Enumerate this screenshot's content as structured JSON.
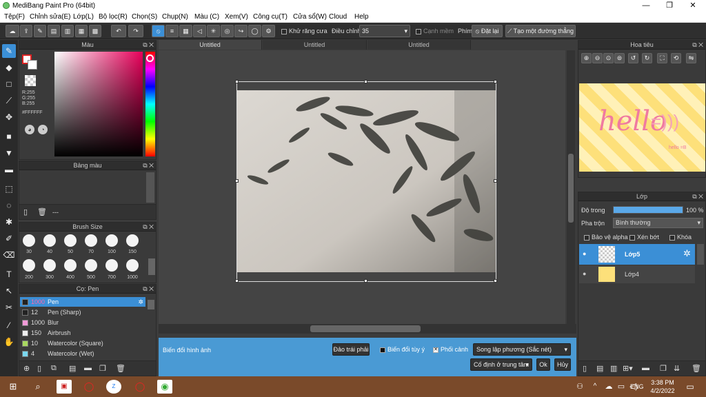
{
  "app": {
    "title": "MediBang Paint Pro (64bit)",
    "minimize": "—",
    "maximize": "❐",
    "close": "✕"
  },
  "menu": [
    "Tệp(F)",
    "Chỉnh sửa(E)",
    "Lớp(L)",
    "Bộ lọc(R)",
    "Chọn(S)",
    "Chụp(N)",
    "Màu (C)",
    "Xem(V)",
    "Công cụ(T)",
    "Cửa sổ(W)",
    "Cloud",
    "Help"
  ],
  "toolbar": {
    "antialias_label": "Khử răng cưa",
    "adjust_label": "Điều chỉnh",
    "adjust_value": "35",
    "smooth_edge_label": "Cạnh mềm",
    "key_label": "Phím",
    "reset_label": "Đặt lại",
    "straight_line_label": "Tạo một đường thẳng"
  },
  "color_panel": {
    "title": "Màu",
    "r": "R:255",
    "g": "G:255",
    "b": "B:255",
    "hex": "#FFFFFF"
  },
  "palette_panel": {
    "title": "Bảng màu",
    "dash": "---"
  },
  "brush_size_panel": {
    "title": "Brush Size",
    "sizes": [
      "30",
      "40",
      "50",
      "70",
      "100",
      "150",
      "200",
      "300",
      "400",
      "500",
      "700",
      "1000"
    ]
  },
  "brush_panel": {
    "title": "Cọ: Pen",
    "items": [
      {
        "size": "1000",
        "name": "Pen",
        "color": "#222222"
      },
      {
        "size": "12",
        "name": "Pen (Sharp)",
        "color": "#222222"
      },
      {
        "size": "1000",
        "name": "Blur",
        "color": "#f29ad8"
      },
      {
        "size": "150",
        "name": "Airbrush",
        "color": "#eeeeee"
      },
      {
        "size": "10",
        "name": "Watercolor (Square)",
        "color": "#a8d860"
      },
      {
        "size": "4",
        "name": "Watercolor (Wet)",
        "color": "#7ad8f0"
      }
    ]
  },
  "tabs": [
    "Untitled",
    "Untitled",
    "Untitled"
  ],
  "navigator": {
    "title": "Hoa tiêu",
    "preview_text": "hello",
    "preview_smiley": "=)))",
    "preview_small": "hello =B"
  },
  "layer_panel": {
    "title": "Lớp",
    "opacity_label": "Độ trong",
    "opacity_value": "100 %",
    "opacity": 1.0,
    "blend_label": "Pha trộn",
    "blend_value": "Bình thường",
    "alpha_label": "Bảo vệ alpha",
    "clip_label": "Xén bớt",
    "lock_label": "Khóa",
    "layers": [
      {
        "name": "Lớp5"
      },
      {
        "name": "Lớp4"
      }
    ]
  },
  "transform_bar": {
    "title": "Biến đổi hình ảnh",
    "flip_label": "Đảo trái phải",
    "free_label": "Biến đổi tùy ý",
    "perspective_label": "Phối cảnh",
    "interp_value": "Song lập phương (Sắc nét)",
    "anchor_value": "Cố định ở trung tâm",
    "ok_label": "Ok",
    "cancel_label": "Hủy"
  },
  "taskbar": {
    "lang": "ENG",
    "time": "3:38 PM",
    "date": "4/2/2022"
  },
  "colors": {
    "accent": "#3b8fd6",
    "bottom_bar": "#4a9ad4"
  }
}
